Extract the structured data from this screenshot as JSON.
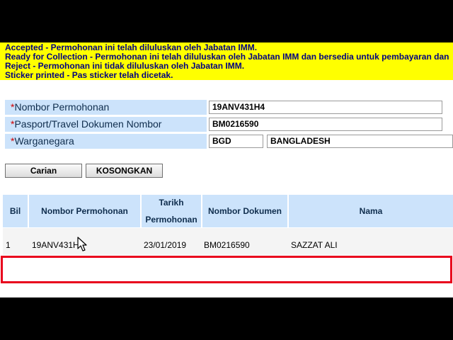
{
  "status_legend": {
    "accepted": "Accepted - Permohonan ini telah diluluskan oleh Jabatan IMM.",
    "ready": "Ready for Collection - Permohonan ini telah diluluskan oleh Jabatan IMM dan bersedia untuk pembayaran dan",
    "reject": "Reject - Permohonan ini tidak diluluskan oleh Jabatan IMM.",
    "sticker": "Sticker printed - Pas sticker telah dicetak."
  },
  "form": {
    "required_mark": "*",
    "application_number": {
      "label": "Nombor Permohonan",
      "value": "19ANV431H4"
    },
    "passport_number": {
      "label": "Pasport/Travel Dokumen Nombor",
      "value": "BM0216590"
    },
    "nationality": {
      "label": "Warganegara",
      "code": "BGD",
      "name": "BANGLADESH"
    }
  },
  "buttons": {
    "search": "Carian",
    "clear": "KOSONGKAN"
  },
  "results": {
    "columns": {
      "bil": "Bil",
      "application_number": "Nombor Permohonan",
      "date_line1": "Tarikh",
      "date_line2": "Permohonan",
      "document_number": "Nombor Dokumen",
      "name": "Nama"
    },
    "rows": [
      {
        "bil": "1",
        "application_number": "19ANV431H4",
        "date": "23/01/2019",
        "document_number": "BM0216590",
        "name": "SAZZAT ALI"
      }
    ]
  },
  "colors": {
    "legend_bg": "#ffff00",
    "legend_text": "#000080",
    "label_bg": "#cce3fb",
    "required": "#d00000",
    "highlight": "#e8001c",
    "letterbox": "#000000"
  }
}
